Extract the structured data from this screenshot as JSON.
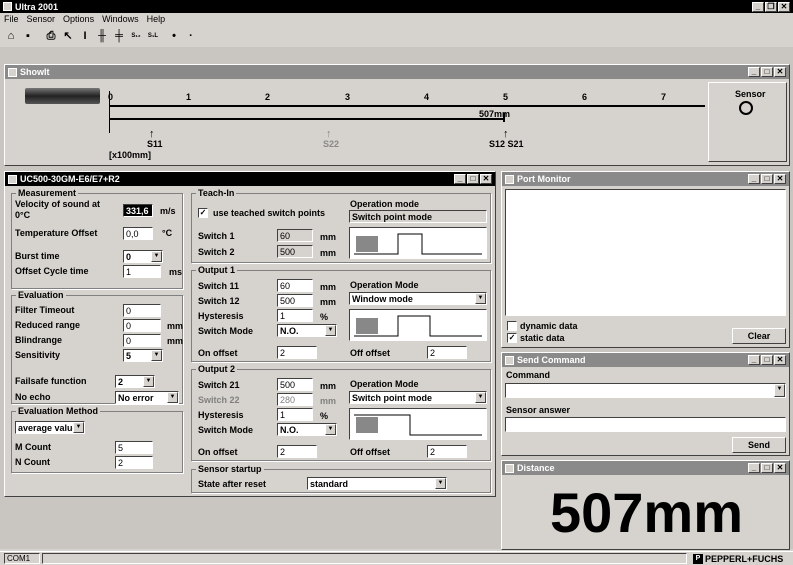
{
  "app": {
    "title": "Ultra 2001"
  },
  "menu": [
    "File",
    "Sensor",
    "Options",
    "Windows",
    "Help"
  ],
  "toolbar_icons": [
    "open-icon",
    "save-icon",
    "print-icon",
    "pointer-icon",
    "text-cursor-icon",
    "bar-chart-icon",
    "bar-chart-2-icon",
    "switch-points-icon",
    "switch-points-2-icon",
    "dot-icon",
    "small-dot-icon"
  ],
  "showit": {
    "title": "ShowIt",
    "scale_labels": [
      "0",
      "1",
      "2",
      "3",
      "4",
      "5",
      "6",
      "7"
    ],
    "unit_label": "[x100mm]",
    "distance_marker": "507mm",
    "markers": [
      {
        "label": "S11",
        "active": true
      },
      {
        "label": "S22",
        "active": false
      },
      {
        "label": "S12 S21",
        "active": true
      }
    ],
    "sensor_label": "Sensor"
  },
  "sensor_window": {
    "title": "UC500-30GM-E6/E7+R2",
    "measurement": {
      "legend": "Measurement",
      "velocity_label": "Velocity of sound at 0°C",
      "velocity_value": "331,6",
      "velocity_unit": "m/s",
      "temp_label": "Temperature Offset",
      "temp_value": "0,0",
      "temp_unit": "°C",
      "burst_label": "Burst time",
      "burst_value": "0",
      "cycle_label": "Offset Cycle time",
      "cycle_value": "1",
      "cycle_unit": "ms"
    },
    "evaluation": {
      "legend": "Evaluation",
      "filter_label": "Filter Timeout",
      "filter_value": "0",
      "reduced_label": "Reduced range",
      "reduced_value": "0",
      "reduced_unit": "mm",
      "blind_label": "Blindrange",
      "blind_value": "0",
      "blind_unit": "mm",
      "sens_label": "Sensitivity",
      "sens_value": "5",
      "failsafe_label": "Failsafe function",
      "failsafe_value": "2",
      "noecho_label": "No echo",
      "noecho_value": "No error"
    },
    "eval_method": {
      "legend": "Evaluation Method",
      "method_value": "average value",
      "m_label": "M Count",
      "m_value": "5",
      "n_label": "N Count",
      "n_value": "2"
    },
    "teach": {
      "legend": "Teach-In",
      "use_label": "use teached switch points",
      "op_label": "Operation mode",
      "op_value": "Switch point mode",
      "s1_label": "Switch 1",
      "s1_value": "60",
      "s2_label": "Switch 2",
      "s2_value": "500",
      "unit": "mm"
    },
    "output1": {
      "legend": "Output 1",
      "s11_label": "Switch 11",
      "s11_value": "60",
      "s12_label": "Switch 12",
      "s12_value": "500",
      "hyst_label": "Hysteresis",
      "hyst_value": "1",
      "hyst_unit": "%",
      "mode_label": "Switch Mode",
      "mode_value": "N.O.",
      "op_label": "Operation Mode",
      "op_value": "Window mode",
      "on_label": "On offset",
      "on_value": "2",
      "off_label": "Off offset",
      "off_value": "2",
      "unit": "mm"
    },
    "output2": {
      "legend": "Output 2",
      "s21_label": "Switch 21",
      "s21_value": "500",
      "s22_label": "Switch 22",
      "s22_value": "280",
      "hyst_label": "Hysteresis",
      "hyst_value": "1",
      "hyst_unit": "%",
      "mode_label": "Switch Mode",
      "mode_value": "N.O.",
      "op_label": "Operation Mode",
      "op_value": "Switch point mode",
      "on_label": "On offset",
      "on_value": "2",
      "off_label": "Off offset",
      "off_value": "2",
      "unit": "mm"
    },
    "startup": {
      "legend": "Sensor startup",
      "state_label": "State after reset",
      "state_value": "standard"
    }
  },
  "port_monitor": {
    "title": "Port Monitor",
    "dynamic_label": "dynamic data",
    "static_label": "static data",
    "clear_label": "Clear"
  },
  "send_command": {
    "title": "Send Command",
    "command_label": "Command",
    "answer_label": "Sensor answer",
    "send_label": "Send"
  },
  "distance": {
    "title": "Distance",
    "value": "507mm"
  },
  "status": {
    "port": "COM1",
    "brand": "PEPPERL+FUCHS"
  }
}
